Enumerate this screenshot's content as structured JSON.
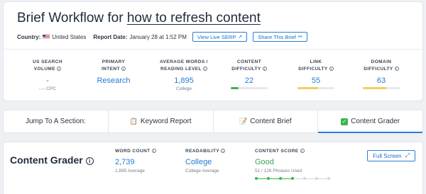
{
  "header": {
    "title_prefix": "Brief Workflow for",
    "keyword": "how to refresh content",
    "country_label": "Country:",
    "country_value": "United States",
    "report_label": "Report Date:",
    "report_value": "January 28 at 1:52 PM",
    "view_serp_label": "View Live SERP",
    "share_label": "Share This Brief"
  },
  "metrics": [
    {
      "label1": "US SEARCH",
      "label2": "VOLUME",
      "value": "-",
      "sub": "-.-- CPC"
    },
    {
      "label1": "PRIMARY",
      "label2": "INTENT",
      "value": "Research",
      "sub": ""
    },
    {
      "label1": "AVERAGE WORDS /",
      "label2": "READING LEVEL",
      "value": "1,895",
      "sub": "College"
    },
    {
      "label1": "CONTENT",
      "label2": "DIFFICULTY",
      "value": "22",
      "bar_pct": 22,
      "bar_color": "#3bb54a"
    },
    {
      "label1": "LINK",
      "label2": "DIFFICULTY",
      "value": "55",
      "bar_pct": 55,
      "bar_color": "#f2cf5b"
    },
    {
      "label1": "DOMAIN",
      "label2": "DIFFICULTY",
      "value": "63",
      "bar_pct": 63,
      "bar_color": "#f2cf5b"
    }
  ],
  "tabs": {
    "jump_label": "Jump To A Section:",
    "items": [
      {
        "label": "Keyword Report",
        "icon": "keyword-report-icon"
      },
      {
        "label": "Content Brief",
        "icon": "content-brief-icon"
      },
      {
        "label": "Content Grader",
        "icon": "check-icon",
        "active": true
      }
    ]
  },
  "grader": {
    "title": "Content Grader",
    "word_count_label": "WORD COUNT",
    "word_count_value": "2,739",
    "word_count_sub": "1,895 Average",
    "readability_label": "READABILITY",
    "readability_value": "College",
    "readability_sub": "College Average",
    "score_label": "CONTENT SCORE",
    "score_value": "Good",
    "score_sub": "51 / 126 Phrases Used",
    "score_steps_filled": 4,
    "score_steps_total": 7,
    "full_screen_label": "Full Screen"
  },
  "colors": {
    "accent": "#1f7bd1",
    "good": "#3aa655",
    "easy_bar": "#3bb54a",
    "medium_bar": "#f2cf5b"
  }
}
